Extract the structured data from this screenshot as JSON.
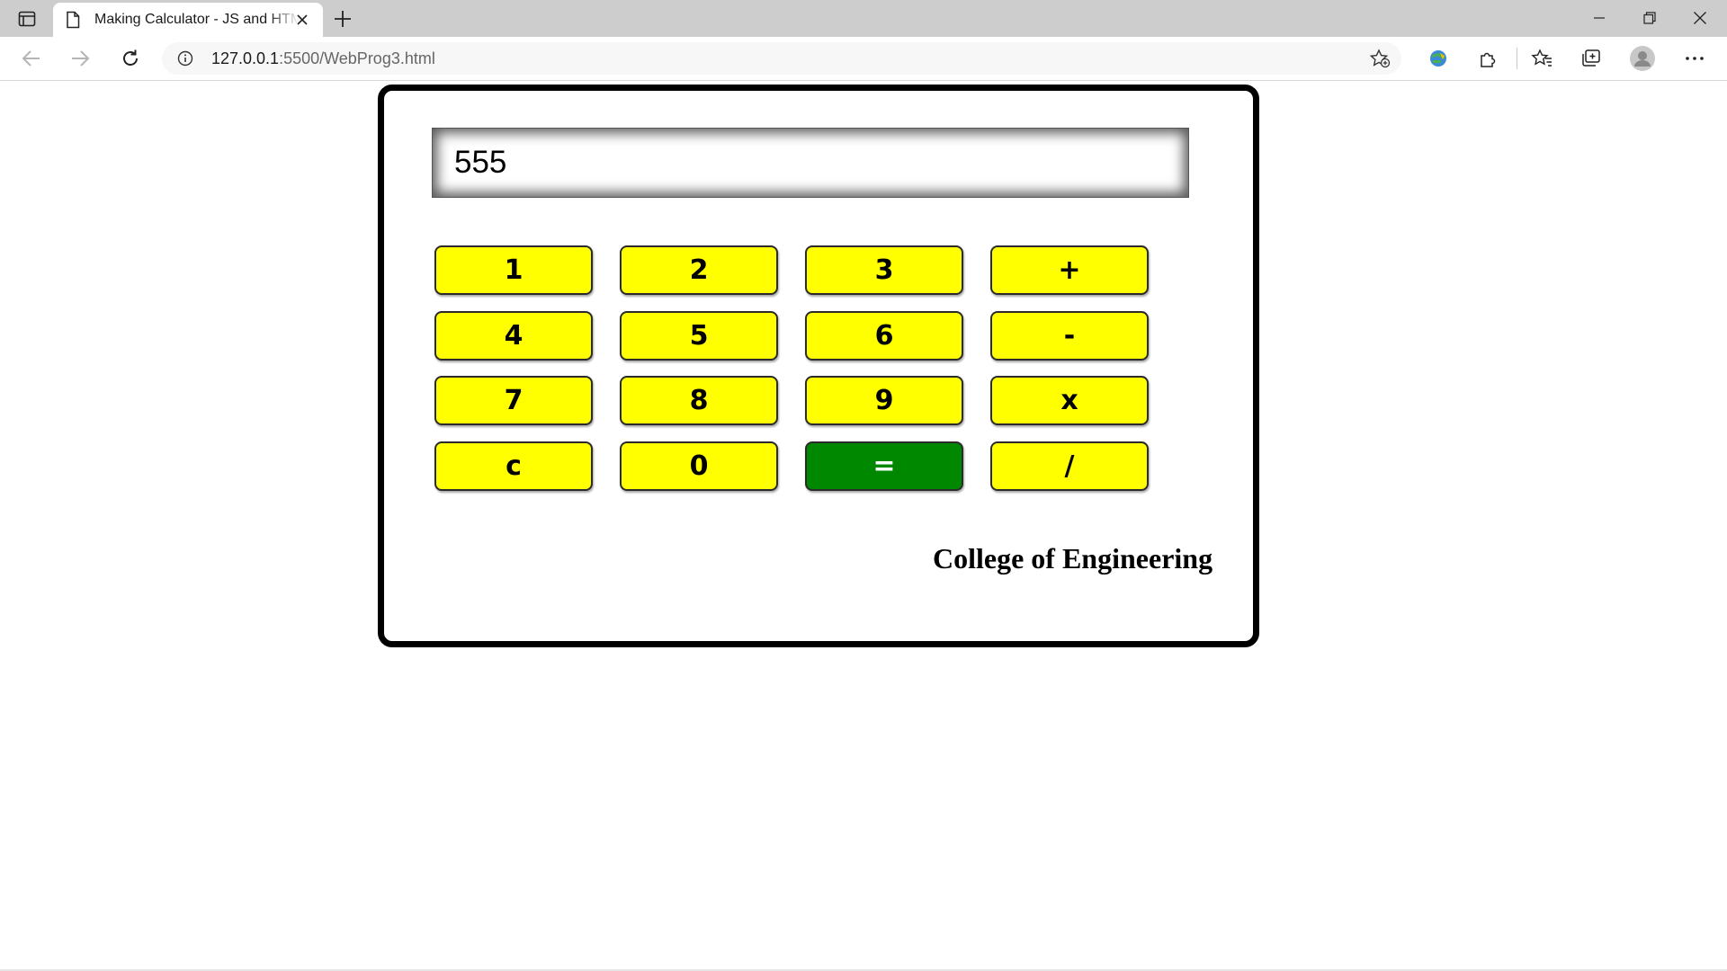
{
  "browser": {
    "tab_title": "Making Calculator - JS and HTML",
    "url_host": "127.0.0.1",
    "url_path": ":5500/WebProg3.html"
  },
  "calculator": {
    "display_value": "555",
    "keys": {
      "k1": "1",
      "k2": "2",
      "k3": "3",
      "plus": "+",
      "k4": "4",
      "k5": "5",
      "k6": "6",
      "minus": "-",
      "k7": "7",
      "k8": "8",
      "k9": "9",
      "times": "x",
      "clear": "c",
      "k0": "0",
      "equals": "=",
      "divide": "/"
    },
    "key_color": "#ffff00",
    "equals_color": "#008800"
  },
  "footer_text": "College of Engineering"
}
